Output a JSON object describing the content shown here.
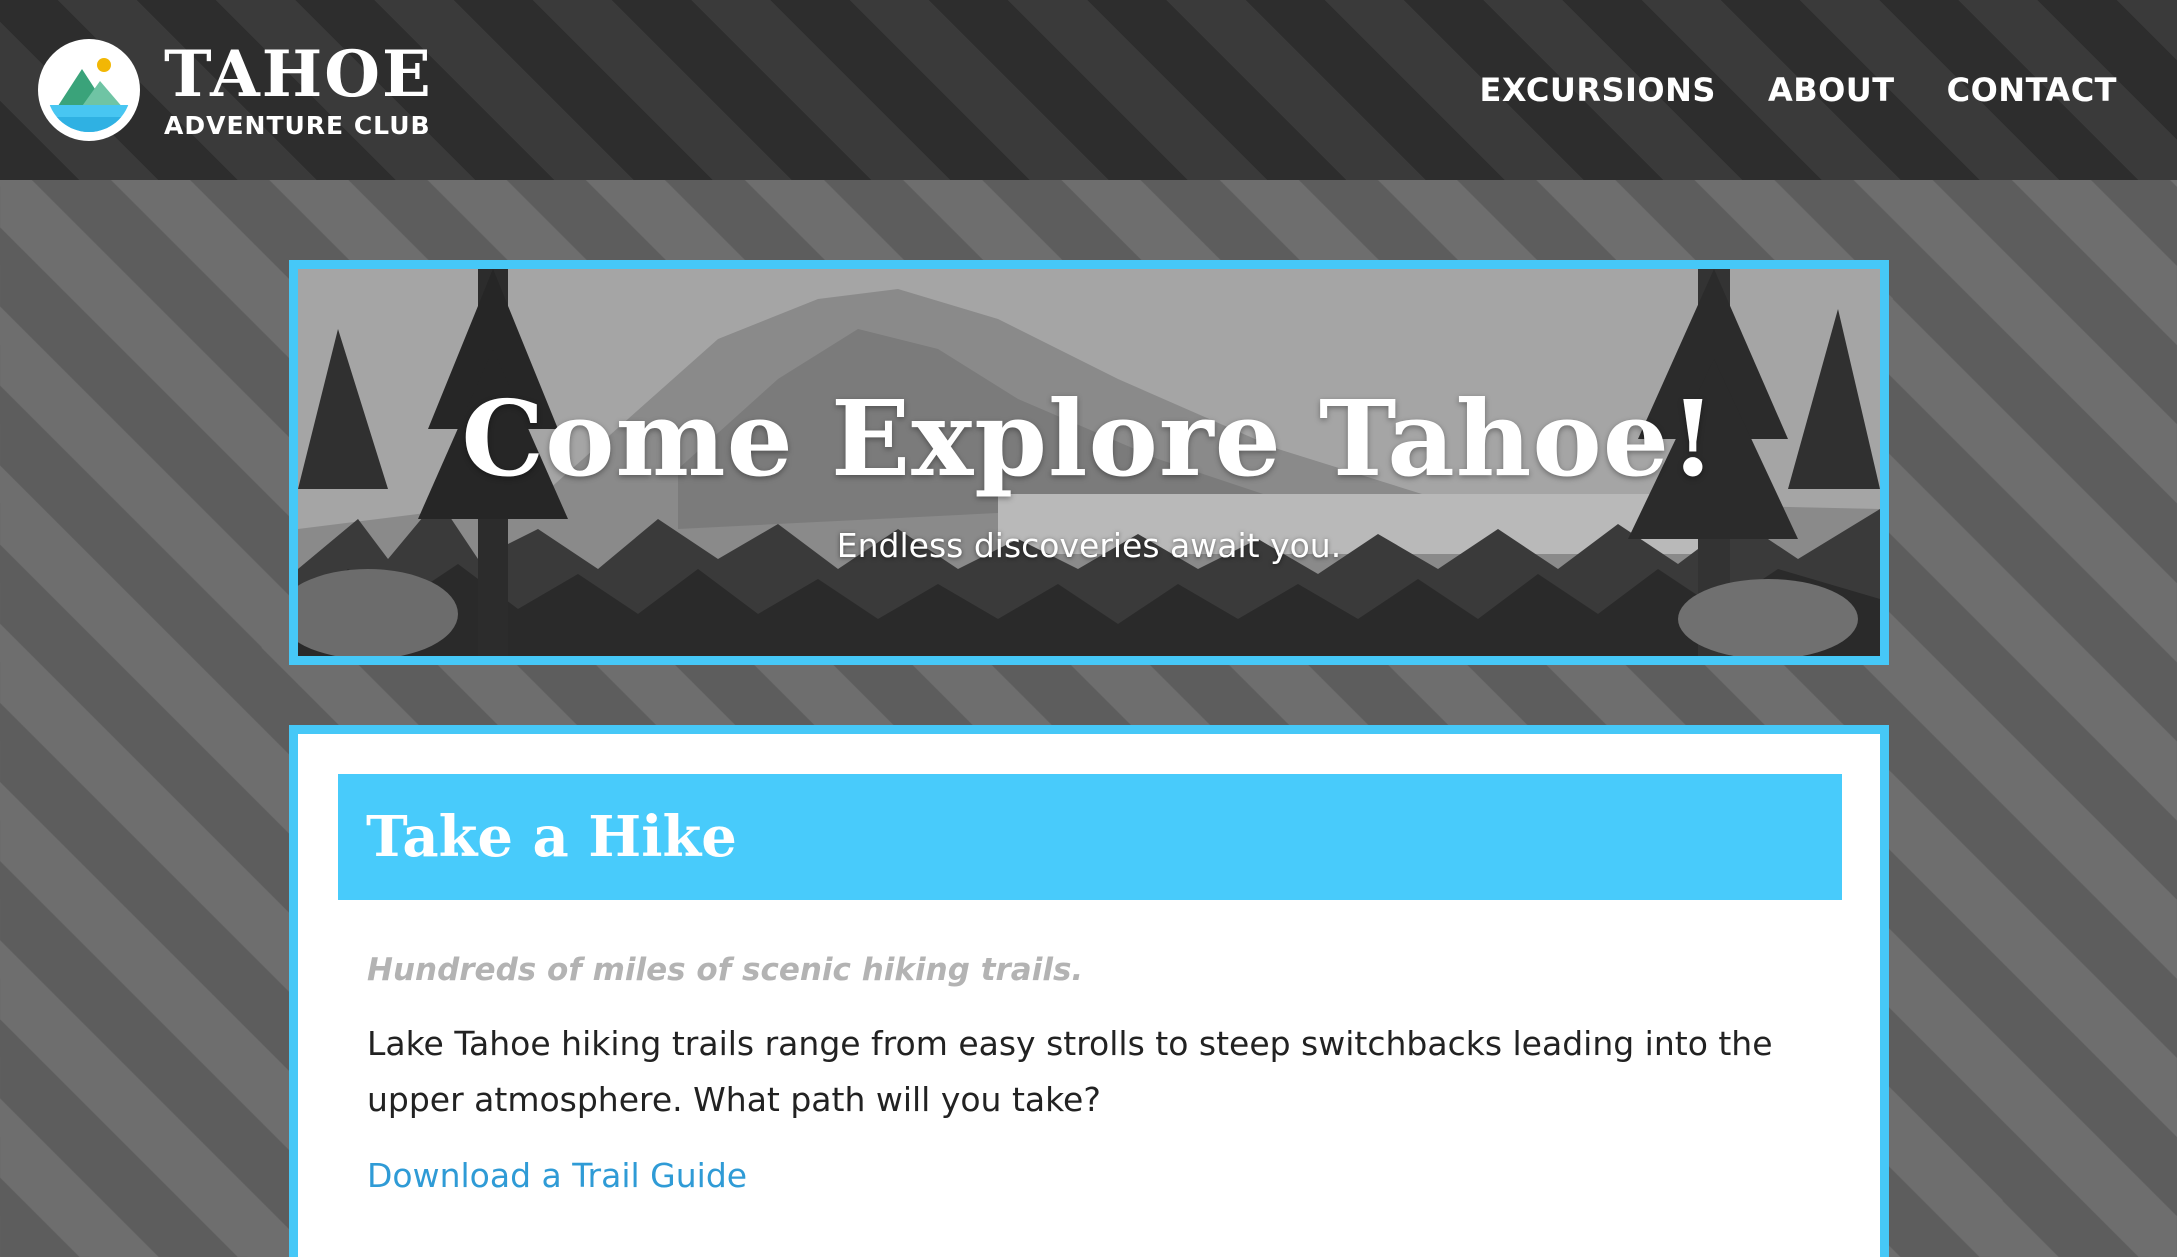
{
  "header": {
    "brand_title": "TAHOE",
    "brand_subtitle": "ADVENTURE CLUB",
    "nav": [
      {
        "label": "EXCURSIONS"
      },
      {
        "label": "ABOUT"
      },
      {
        "label": "CONTACT"
      }
    ]
  },
  "hero": {
    "title": "Come Explore Tahoe!",
    "subtitle": "Endless discoveries await you."
  },
  "card": {
    "title": "Take a Hike",
    "tagline": "Hundreds of miles of scenic hiking trails.",
    "body": "Lake Tahoe hiking trails range from easy strolls to steep switchbacks leading into the upper atmosphere. What path will you take?",
    "link_label": "Download a Trail Guide"
  },
  "colors": {
    "accent": "#46c8f7",
    "header_bg": "#2e2e2e",
    "link": "#2f9bd6",
    "tagline": "#b3b3b3"
  },
  "icons": {
    "logo": "mountain-lake-logo-icon"
  }
}
